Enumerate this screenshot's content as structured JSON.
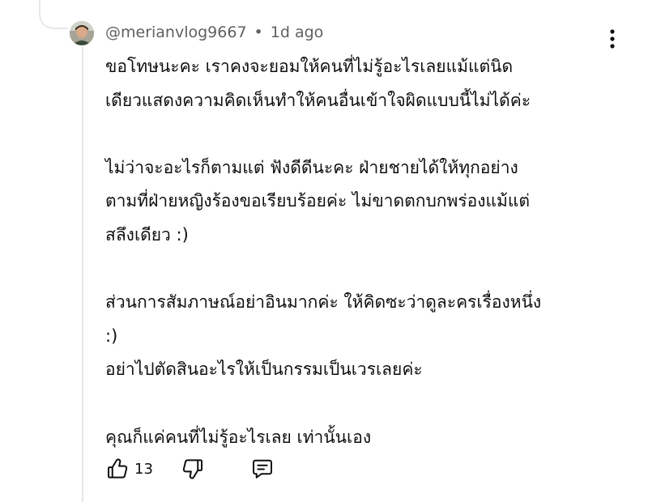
{
  "comment": {
    "author": "@merianvlog9667",
    "separator": "•",
    "time_ago": "1d ago",
    "paragraphs": [
      [
        "ขอโทษนะคะ เราคงจะยอมให้คนที่ไม่รู้อะไรเลยแม้แต่นิด",
        "เดียวแสดงความคิดเห็นทำให้คนอื่นเข้าใจผิดแบบนี้ไม่ได้ค่ะ"
      ],
      [
        "ไม่ว่าจะอะไรก็ตามแต่ ฟังดีดีนะคะ ฝ่ายชายได้ให้ทุกอย่าง",
        "ตามที่ฝ่ายหญิงร้องขอเรียบร้อยค่ะ ไม่ขาดตกบกพร่องแม้แต่",
        "สลึงเดียว :)"
      ],
      [
        "ส่วนการสัมภาษณ์อย่าอินมากค่ะ ให้คิดซะว่าดูละครเรื่องหนึ่ง",
        ":)",
        "อย่าไปตัดสินอะไรให้เป็นกรรมเป็นเวรเลยค่ะ"
      ],
      [
        "คุณก็แค่คนที่ไม่รู้อะไรเลย เท่านั้นเอง"
      ]
    ]
  },
  "actions": {
    "like_count": "13",
    "like_icon": "thumbs-up-icon",
    "dislike_icon": "thumbs-down-icon",
    "reply_icon": "reply-comment-icon",
    "menu_icon": "more-vertical-icon"
  },
  "colors": {
    "text": "#0f0f0f",
    "meta_text": "#606060",
    "thread_line": "#e8e8e8"
  }
}
